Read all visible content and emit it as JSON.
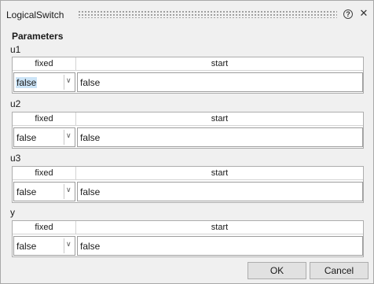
{
  "window": {
    "title": "LogicalSwitch"
  },
  "parameters_title": "Parameters",
  "columns": {
    "fixed": "fixed",
    "start": "start"
  },
  "groups": [
    {
      "label": "u1",
      "fixed_value": "false",
      "start_value": "false"
    },
    {
      "label": "u2",
      "fixed_value": "false",
      "start_value": "false"
    },
    {
      "label": "u3",
      "fixed_value": "false",
      "start_value": "false"
    },
    {
      "label": "y",
      "fixed_value": "false",
      "start_value": "false"
    }
  ],
  "buttons": {
    "ok": "OK",
    "cancel": "Cancel"
  },
  "icons": {
    "help": "help-icon",
    "close": "close-icon",
    "dropdown": "chevron-down-icon"
  }
}
